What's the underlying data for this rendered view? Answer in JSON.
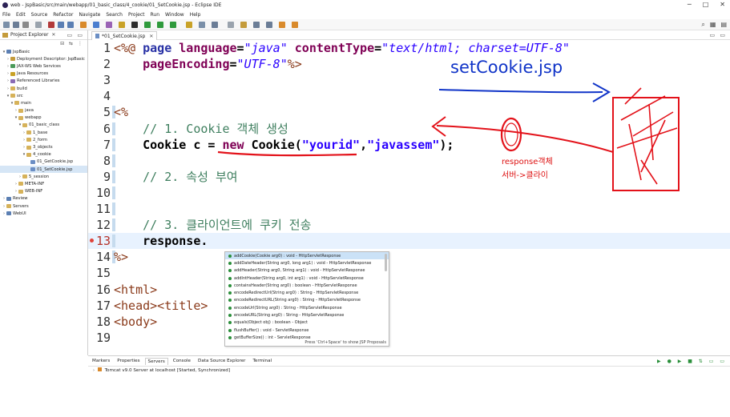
{
  "window": {
    "title": "web - JspBasic/src/main/webapp/01_basic_class/4_cookie/01_SetCookie.jsp - Eclipse IDE"
  },
  "menu": [
    "File",
    "Edit",
    "Source",
    "Refactor",
    "Navigate",
    "Search",
    "Project",
    "Run",
    "Window",
    "Help"
  ],
  "explorer": {
    "title": "Project Explorer",
    "items": [
      {
        "label": "JspBasic",
        "level": 0,
        "arrow": "▾",
        "icon": "project-icon"
      },
      {
        "label": "Deployment Descriptor: JspBasic",
        "level": 1,
        "arrow": "›",
        "icon": "descriptor-icon"
      },
      {
        "label": "JAX-WS Web Services",
        "level": 1,
        "arrow": "›",
        "icon": "webservice-icon"
      },
      {
        "label": "Java Resources",
        "level": 1,
        "arrow": "›",
        "icon": "java-resources-icon"
      },
      {
        "label": "Referenced Libraries",
        "level": 1,
        "arrow": "›",
        "icon": "library-icon"
      },
      {
        "label": "build",
        "level": 1,
        "arrow": "›",
        "icon": "folder-icon"
      },
      {
        "label": "src",
        "level": 1,
        "arrow": "▾",
        "icon": "folder-icon"
      },
      {
        "label": "main",
        "level": 2,
        "arrow": "▾",
        "icon": "folder-icon"
      },
      {
        "label": "java",
        "level": 3,
        "arrow": "›",
        "icon": "folder-icon"
      },
      {
        "label": "webapp",
        "level": 3,
        "arrow": "▾",
        "icon": "folder-icon"
      },
      {
        "label": "01_basic_class",
        "level": 4,
        "arrow": "▾",
        "icon": "folder-icon"
      },
      {
        "label": "1_base",
        "level": 5,
        "arrow": "›",
        "icon": "folder-icon"
      },
      {
        "label": "2_form",
        "level": 5,
        "arrow": "›",
        "icon": "folder-icon"
      },
      {
        "label": "3_objects",
        "level": 5,
        "arrow": "›",
        "icon": "folder-icon"
      },
      {
        "label": "4_cookie",
        "level": 5,
        "arrow": "▾",
        "icon": "folder-icon"
      },
      {
        "label": "01_GetCookie.jsp",
        "level": 6,
        "arrow": "",
        "icon": "jsp-file-icon"
      },
      {
        "label": "01_SetCookie.jsp",
        "level": 6,
        "arrow": "",
        "icon": "jsp-file-icon",
        "selected": true
      },
      {
        "label": "5_session",
        "level": 4,
        "arrow": "›",
        "icon": "folder-icon"
      },
      {
        "label": "META-INF",
        "level": 3,
        "arrow": "›",
        "icon": "folder-icon"
      },
      {
        "label": "WEB-INF",
        "level": 3,
        "arrow": "›",
        "icon": "folder-icon"
      },
      {
        "label": "Review",
        "level": 0,
        "arrow": "›",
        "icon": "project-icon"
      },
      {
        "label": "Servers",
        "level": 0,
        "arrow": "›",
        "icon": "folder-icon"
      },
      {
        "label": "WebUI",
        "level": 0,
        "arrow": "›",
        "icon": "project-icon"
      }
    ]
  },
  "editor": {
    "tab_label": "*01_SetCookie.jsp",
    "lines": [
      {
        "num": "1",
        "tokens": [
          {
            "t": "<%@ ",
            "c": "tag"
          },
          {
            "t": "page ",
            "c": "dir"
          },
          {
            "t": "language",
            "c": "attr"
          },
          {
            "t": "=",
            "c": "plain"
          },
          {
            "t": "\"java\" ",
            "c": "str"
          },
          {
            "t": "contentType",
            "c": "attr"
          },
          {
            "t": "=",
            "c": "plain"
          },
          {
            "t": "\"text/html; charset=UTF-8\"",
            "c": "str"
          }
        ]
      },
      {
        "num": "2",
        "tokens": [
          {
            "t": "    ",
            "c": "plain"
          },
          {
            "t": "pageEncoding",
            "c": "attr"
          },
          {
            "t": "=",
            "c": "plain"
          },
          {
            "t": "\"UTF-8\"",
            "c": "str"
          },
          {
            "t": "%>",
            "c": "tag"
          }
        ]
      },
      {
        "num": "3",
        "tokens": []
      },
      {
        "num": "4",
        "tokens": []
      },
      {
        "num": "5",
        "tokens": [
          {
            "t": "<%",
            "c": "tag"
          }
        ]
      },
      {
        "num": "6",
        "tokens": [
          {
            "t": "    // 1. Cookie 객체 생성",
            "c": "cmt"
          }
        ]
      },
      {
        "num": "7",
        "tokens": [
          {
            "t": "    Cookie c = ",
            "c": "plain"
          },
          {
            "t": "new ",
            "c": "kw"
          },
          {
            "t": "Cookie(",
            "c": "plain"
          },
          {
            "t": "\"yourid\"",
            "c": "js-str"
          },
          {
            "t": ",",
            "c": "plain"
          },
          {
            "t": "\"javassem\"",
            "c": "js-str"
          },
          {
            "t": ");",
            "c": "plain"
          }
        ]
      },
      {
        "num": "8",
        "tokens": []
      },
      {
        "num": "9",
        "tokens": [
          {
            "t": "    // 2. 속성 부여",
            "c": "cmt"
          }
        ]
      },
      {
        "num": "10",
        "tokens": []
      },
      {
        "num": "11",
        "tokens": []
      },
      {
        "num": "12",
        "tokens": [
          {
            "t": "    // 3. 클라이언트에 쿠키 전송",
            "c": "cmt"
          }
        ]
      },
      {
        "num": "13",
        "tokens": [
          {
            "t": "    response.",
            "c": "plain"
          }
        ],
        "error": true,
        "current": true
      },
      {
        "num": "14",
        "tokens": [
          {
            "t": "%>",
            "c": "tag"
          }
        ]
      },
      {
        "num": "15",
        "tokens": []
      },
      {
        "num": "16",
        "tokens": [
          {
            "t": "<html>",
            "c": "tag"
          }
        ]
      },
      {
        "num": "17",
        "tokens": [
          {
            "t": "<head><title>",
            "c": "tag"
          }
        ]
      },
      {
        "num": "18",
        "tokens": [
          {
            "t": "<body>",
            "c": "tag"
          }
        ]
      },
      {
        "num": "19",
        "tokens": []
      }
    ]
  },
  "autocomplete": {
    "items": [
      "addCookie(Cookie arg0) : void - HttpServletResponse",
      "addDateHeader(String arg0, long arg1) : void - HttpServletResponse",
      "addHeader(String arg0, String arg1) : void - HttpServletResponse",
      "addIntHeader(String arg0, int arg1) : void - HttpServletResponse",
      "containsHeader(String arg0) : boolean - HttpServletResponse",
      "encodeRedirectUrl(String arg0) : String - HttpServletResponse",
      "encodeRedirectURL(String arg0) : String - HttpServletResponse",
      "encodeUrl(String arg0) : String - HttpServletResponse",
      "encodeURL(String arg0) : String - HttpServletResponse",
      "equals(Object obj) : boolean - Object",
      "flushBuffer() : void - ServletResponse",
      "getBufferSize() : int - ServletResponse"
    ],
    "footer": "Press 'Ctrl+Space' to show JSP Proposals"
  },
  "bottom": {
    "tabs": [
      "Markers",
      "Properties",
      "Servers",
      "Console",
      "Data Source Explorer",
      "Terminal"
    ],
    "active_tab": "Servers",
    "server_row": "Tomcat v9.0 Server at localhost  [Started, Synchronized]"
  },
  "annotations": {
    "title": "setCookie.jsp",
    "note_line1": "response객체",
    "note_line2": "서버->클라이"
  },
  "colors": {
    "annotation_red": "#e3121a",
    "annotation_blue": "#1034c8",
    "current_line": "#e8f2fe"
  }
}
